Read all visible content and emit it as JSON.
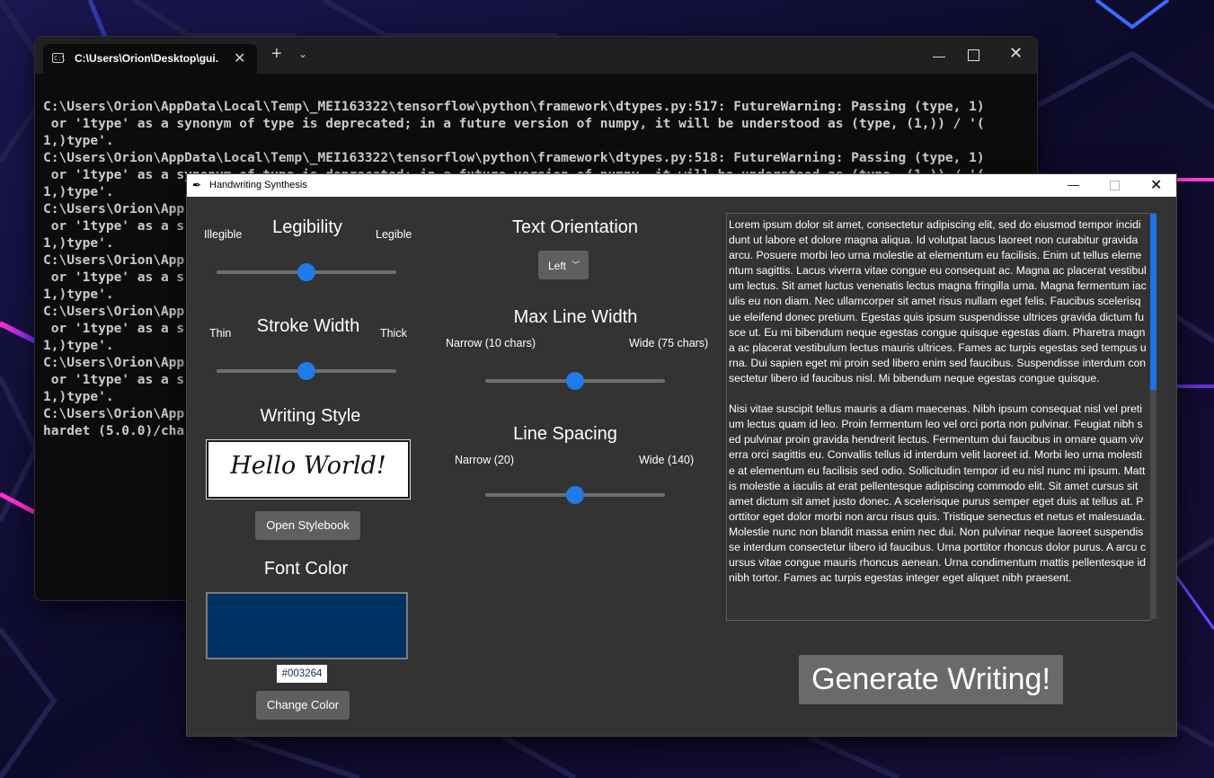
{
  "terminal": {
    "tab_title": "C:\\Users\\Orion\\Desktop\\gui.e",
    "tab_icon": "terminal-icon",
    "new_tab": "+",
    "dropdown": "⌄",
    "lines": [
      "C:\\Users\\Orion\\AppData\\Local\\Temp\\_MEI163322\\tensorflow\\python\\framework\\dtypes.py:517: FutureWarning: Passing (type, 1)",
      " or '1type' as a synonym of type is deprecated; in a future version of numpy, it will be understood as (type, (1,)) / '(",
      "1,)type'.",
      "C:\\Users\\Orion\\AppData\\Local\\Temp\\_MEI163322\\tensorflow\\python\\framework\\dtypes.py:518: FutureWarning: Passing (type, 1)",
      " or '1type' as a synonym of type is deprecated; in a future version of numpy, it will be understood as (type, (1,)) / '(",
      "1,)type'.",
      "C:\\Users\\Orion\\App",
      " or '1type' as a s",
      "1,)type'.",
      "C:\\Users\\Orion\\App",
      " or '1type' as a s",
      "1,)type'.",
      "C:\\Users\\Orion\\App",
      " or '1type' as a s",
      "1,)type'.",
      "C:\\Users\\Orion\\App",
      " or '1type' as a s",
      "1,)type'.",
      "C:\\Users\\Orion\\App",
      "hardet (5.0.0)/cha"
    ]
  },
  "app": {
    "title": "Handwriting Synthesis",
    "icon": "quill-icon",
    "legibility": {
      "heading": "Legibility",
      "min_label": "Illegible",
      "max_label": "Legible",
      "value": 0.5
    },
    "stroke_width": {
      "heading": "Stroke Width",
      "min_label": "Thin",
      "max_label": "Thick",
      "value": 0.5
    },
    "writing_style": {
      "heading": "Writing Style",
      "sample": "Hello World!",
      "button": "Open Stylebook"
    },
    "font_color": {
      "heading": "Font Color",
      "color": "#003264",
      "hex_label": "#003264",
      "button": "Change Color"
    },
    "text_orientation": {
      "heading": "Text Orientation",
      "value": "Left"
    },
    "max_line_width": {
      "heading": "Max Line Width",
      "min_label": "Narrow (10 chars)",
      "max_label": "Wide (75 chars)",
      "value": 0.5
    },
    "line_spacing": {
      "heading": "Line Spacing",
      "min_label": "Narrow (20)",
      "max_label": "Wide (140)",
      "value": 0.5
    },
    "text_input": "Lorem ipsum dolor sit amet, consectetur adipiscing elit, sed do eiusmod tempor incididunt ut labore et dolore magna aliqua. Id volutpat lacus laoreet non curabitur gravida arcu. Posuere morbi leo urna molestie at elementum eu facilisis. Enim ut tellus elementum sagittis. Lacus viverra vitae congue eu consequat ac. Magna ac placerat vestibulum lectus. Sit amet luctus venenatis lectus magna fringilla urna. Magna fermentum iaculis eu non diam. Nec ullamcorper sit amet risus nullam eget felis. Faucibus scelerisque eleifend donec pretium. Egestas quis ipsum suspendisse ultrices gravida dictum fusce ut. Eu mi bibendum neque egestas congue quisque egestas diam. Pharetra magna ac placerat vestibulum lectus mauris ultrices. Fames ac turpis egestas sed tempus urna. Dui sapien eget mi proin sed libero enim sed faucibus. Suspendisse interdum consectetur libero id faucibus nisl. Mi bibendum neque egestas congue quisque.\n\nNisi vitae suscipit tellus mauris a diam maecenas. Nibh ipsum consequat nisl vel pretium lectus quam id leo. Proin fermentum leo vel orci porta non pulvinar. Feugiat nibh sed pulvinar proin gravida hendrerit lectus. Fermentum dui faucibus in ornare quam viverra orci sagittis eu. Convallis tellus id interdum velit laoreet id. Morbi leo urna molestie at elementum eu facilisis sed odio. Sollicitudin tempor id eu nisl nunc mi ipsum. Mattis molestie a iaculis at erat pellentesque adipiscing commodo elit. Sit amet cursus sit amet dictum sit amet justo donec. A scelerisque purus semper eget duis at tellus at. Porttitor eget dolor morbi non arcu risus quis. Tristique senectus et netus et malesuada. Molestie nunc non blandit massa enim nec dui. Non pulvinar neque laoreet suspendisse interdum consectetur libero id faucibus. Urna porttitor rhoncus dolor purus. A arcu cursus vitae congue mauris rhoncus aenean. Urna condimentum mattis pellentesque id nibh tortor. Fames ac turpis egestas integer eget aliquet nibh praesent.",
    "generate_button": "Generate Writing!",
    "accent_color": "#1f7be8"
  }
}
